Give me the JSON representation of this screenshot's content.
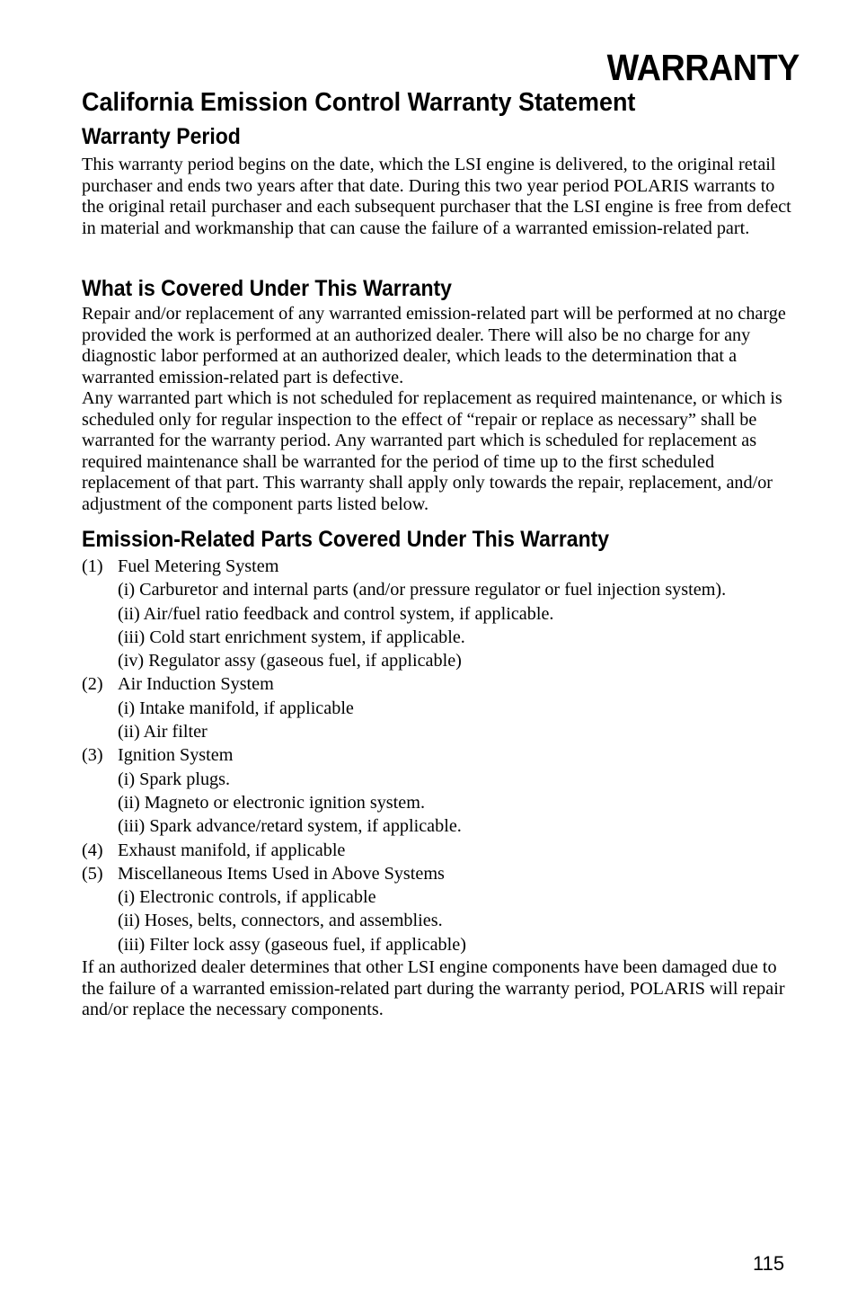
{
  "header": {
    "section_title": "WARRANTY"
  },
  "statement_title": "California Emission Control Warranty Statement",
  "sections": {
    "warranty_period": {
      "heading": "Warranty Period",
      "paragraph": "This warranty period begins on the date, which the LSI engine is delivered, to the original retail purchaser and ends two years after that date. During this two year period POLARIS warrants to the original retail purchaser and each subsequent purchaser that the LSI engine is free from defect in material and workmanship that can cause the failure of a warranted emission-related part."
    },
    "coverage": {
      "heading": "What is Covered Under This Warranty",
      "paragraphs": [
        "Repair and/or replacement of any warranted emission-related part will be performed at no charge provided the work is performed at an authorized dealer. There will also be no charge for any diagnostic labor performed at an authorized dealer, which leads to the determination that a warranted emission-related part is defective.",
        "Any warranted part which is not scheduled for replacement as required maintenance, or which is scheduled only for regular inspection to the effect of “repair or replace as necessary” shall be warranted for the warranty period. Any warranted part which is scheduled for replacement as required maintenance shall be warranted for the period of time up to the first scheduled replacement of that part. This warranty shall apply only towards the repair, replacement, and/or adjustment of the component parts listed below."
      ]
    },
    "parts": {
      "heading": "Emission-Related Parts Covered Under This Warranty",
      "items": [
        {
          "num": "(1)",
          "label": "Fuel Metering System",
          "subitems": [
            "(i) Carburetor and internal parts (and/or pressure regulator or fuel injection system).",
            "(ii) Air/fuel ratio feedback and control system, if applicable.",
            "(iii) Cold start enrichment system, if applicable.",
            "(iv) Regulator assy (gaseous fuel, if applicable)"
          ]
        },
        {
          "num": "(2)",
          "label": "Air Induction System",
          "subitems": [
            "(i) Intake manifold, if applicable",
            "(ii) Air filter"
          ]
        },
        {
          "num": "(3)",
          "label": "Ignition System",
          "subitems": [
            "(i) Spark plugs.",
            "(ii) Magneto or electronic ignition system.",
            "(iii) Spark advance/retard system, if applicable."
          ]
        },
        {
          "num": "(4)",
          "label": "Exhaust manifold, if applicable",
          "subitems": []
        },
        {
          "num": "(5)",
          "label": "Miscellaneous Items Used in Above Systems",
          "subitems": [
            "(i) Electronic controls, if applicable",
            "(ii) Hoses, belts, connectors, and assemblies.",
            "(iii) Filter lock assy (gaseous fuel, if applicable)"
          ]
        }
      ],
      "closing_paragraph": "If an authorized dealer determines that other LSI engine components have been damaged due to the failure of a warranted emission-related part during the warranty period, POLARIS will repair and/or replace the necessary components."
    }
  },
  "footer": {
    "page_number": "115"
  }
}
